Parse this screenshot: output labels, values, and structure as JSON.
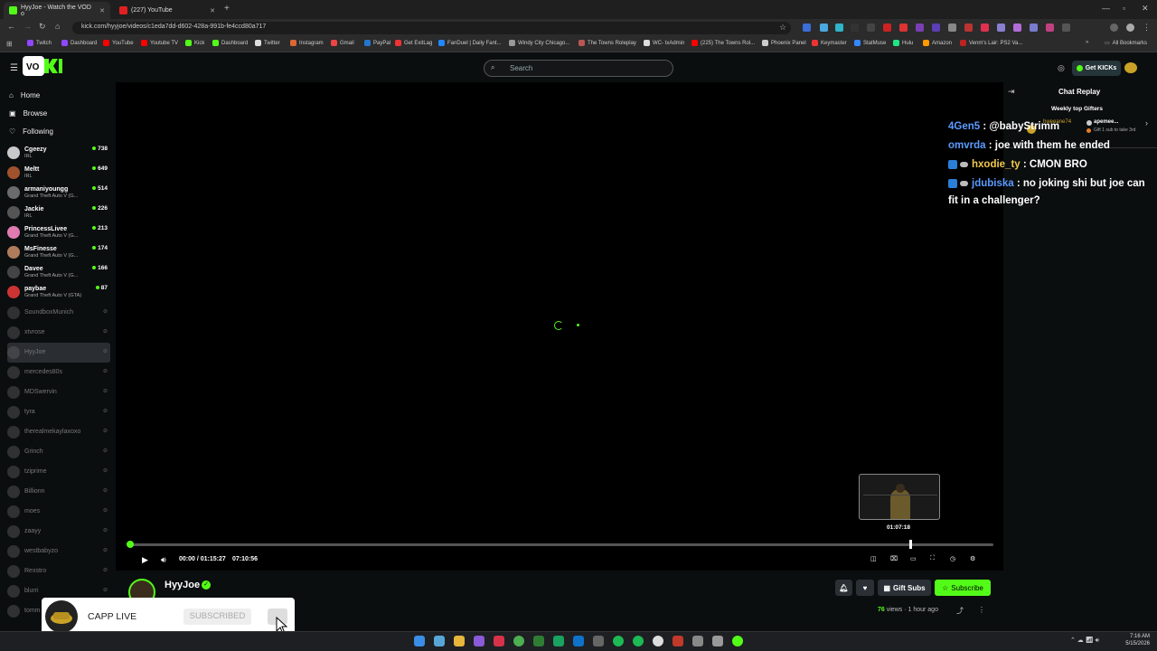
{
  "browser": {
    "tabs": [
      {
        "title": "HyyJoe - Watch the VOD o",
        "active": true
      },
      {
        "title": "(227) YouTube",
        "active": false
      }
    ],
    "url": "kick.com/hyyjoe/videos/c1eda7dd-d602-428a-991b-fe4ccd80a717",
    "bookmarks": [
      "Twitch",
      "Dashboard",
      "YouTube",
      "Youtube TV",
      "Kick",
      "Dashboard",
      "Twitter",
      "Instagram",
      "Gmail",
      "PayPal",
      "Get ExitLag",
      "FanDuel | Daily Fant...",
      "Windy City Chicago...",
      "The Towns Roleplay",
      "WC- txAdmin",
      "(225) The Towns Rol...",
      "Phoenix Panel",
      "Keymaster",
      "StatMuse",
      "Hulu",
      "Amazon",
      "Venm's Lair: PS2 Va..."
    ],
    "all_bookmarks": "All Bookmarks"
  },
  "header": {
    "search_placeholder": "Search",
    "get_kicks": "Get KICKs"
  },
  "nav": [
    {
      "label": "Home",
      "icon": "home-icon"
    },
    {
      "label": "Browse",
      "icon": "compass-icon"
    },
    {
      "label": "Following",
      "icon": "heart-icon"
    }
  ],
  "live_channels": [
    {
      "name": "Cgeezy",
      "category": "IRL",
      "viewers": "738"
    },
    {
      "name": "Meltt",
      "category": "IRL",
      "viewers": "649"
    },
    {
      "name": "armaniyoungg",
      "category": "Grand Theft Auto V (G...",
      "viewers": "514"
    },
    {
      "name": "Jackie",
      "category": "IRL",
      "viewers": "226"
    },
    {
      "name": "PrincessLivee",
      "category": "Grand Theft Auto V (G...",
      "viewers": "213"
    },
    {
      "name": "MsFinesse",
      "category": "Grand Theft Auto V (G...",
      "viewers": "174"
    },
    {
      "name": "Davee",
      "category": "Grand Theft Auto V (G...",
      "viewers": "166"
    },
    {
      "name": "paybae",
      "category": "Grand Theft Auto V (GTA)",
      "viewers": "87"
    }
  ],
  "offline_channels": [
    "SoundboxMunich",
    "xtvrose",
    "HyyJoe",
    "mercedes80s",
    "MDSwervin",
    "tyra",
    "therealmekaylaxoxo",
    "Grinch",
    "tziprime",
    "Billionn",
    "moes",
    "zaayy",
    "westbabyzo",
    "Rexstro",
    "blurri",
    "tomm"
  ],
  "player": {
    "time_current": "00:00",
    "time_total": "01:15:27",
    "time_extra": "07:10:56",
    "hover_time": "01:07:18",
    "progress_fraction": 0.0
  },
  "chat": {
    "title": "Chat Replay",
    "gifters_title": "Weekly top Gifters",
    "gifter_name": "apemee...",
    "gifter_name_2": "hweeane74",
    "gifter_note": "Gift 1 sub to take 3rd",
    "messages": [
      {
        "user": "4Gen5",
        "color": "#5b9bff",
        "text": "@babyStrimm",
        "badges": false
      },
      {
        "user": "omvrda",
        "color": "#5b9bff",
        "text": "joe with them he ended",
        "badges": false
      },
      {
        "user": "hxodie_ty",
        "color": "#f2c94c",
        "text": "CMON BRO",
        "badges": true
      },
      {
        "user": "jdubiska",
        "color": "#5b9bff",
        "text": "no joking shi but joe can fit in a challenger?",
        "badges": true
      }
    ]
  },
  "channel": {
    "name": "HyyJoe",
    "views_count": "76",
    "views_label": "views",
    "posted": "1 hour ago",
    "gift_subs": "Gift Subs",
    "subscribe": "Subscribe"
  },
  "popup": {
    "name": "CAPP LIVE",
    "status": "SUBSCRIBED"
  },
  "taskbar": {
    "time": "7:16 AM",
    "date": "5/15/2026"
  },
  "colors": {
    "accent": "#53fc18",
    "bg": "#0b0e0f"
  }
}
